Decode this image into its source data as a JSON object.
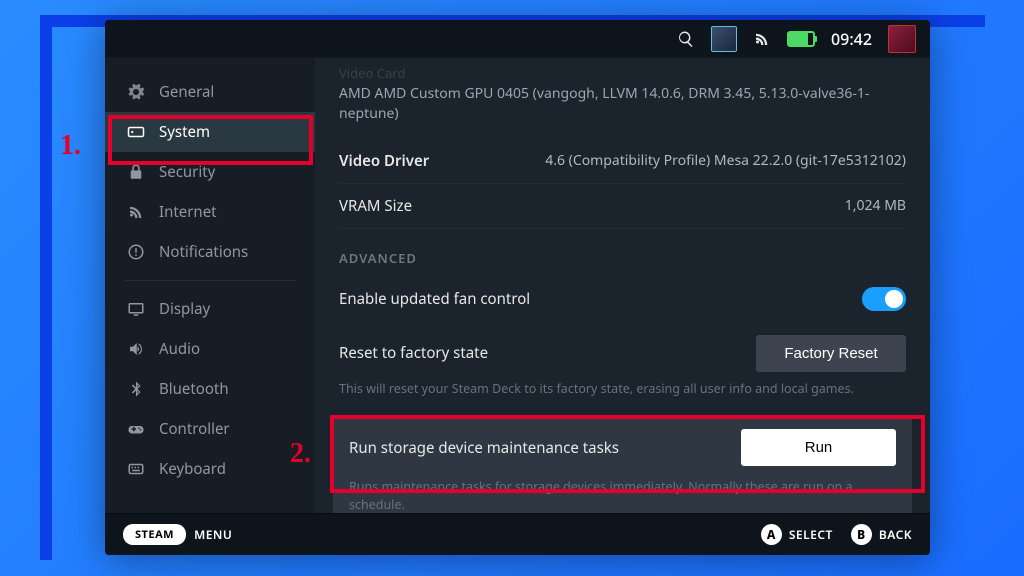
{
  "status_bar": {
    "time": "09:42"
  },
  "sidebar": {
    "items": [
      {
        "id": "general",
        "label": "General"
      },
      {
        "id": "system",
        "label": "System",
        "active": true
      },
      {
        "id": "security",
        "label": "Security"
      },
      {
        "id": "internet",
        "label": "Internet"
      },
      {
        "id": "notifications",
        "label": "Notifications"
      },
      {
        "id": "display",
        "label": "Display"
      },
      {
        "id": "audio",
        "label": "Audio"
      },
      {
        "id": "bluetooth",
        "label": "Bluetooth"
      },
      {
        "id": "controller",
        "label": "Controller"
      },
      {
        "id": "keyboard",
        "label": "Keyboard"
      }
    ]
  },
  "content": {
    "video_card_label": "Video Card",
    "video_card_value": "AMD AMD Custom GPU 0405 (vangogh, LLVM 14.0.6, DRM 3.45, 5.13.0-valve36-1-neptune)",
    "video_driver_label": "Video Driver",
    "video_driver_value": "4.6 (Compatibility Profile) Mesa 22.2.0 (git-17e5312102)",
    "vram_label": "VRAM Size",
    "vram_value": "1,024 MB",
    "advanced_title": "ADVANCED",
    "fan_label": "Enable updated fan control",
    "reset_label": "Reset to factory state",
    "reset_button": "Factory Reset",
    "reset_desc": "This will reset your Steam Deck to its factory state, erasing all user info and local games.",
    "maint_label": "Run storage device maintenance tasks",
    "maint_button": "Run",
    "maint_desc": "Runs maintenance tasks for storage devices immediately. Normally these are run on a schedule."
  },
  "bottom": {
    "steam_label": "STEAM",
    "menu_label": "MENU",
    "select_label": "SELECT",
    "select_key": "A",
    "back_label": "BACK",
    "back_key": "B"
  },
  "annotations": {
    "step1": "1.",
    "step2": "2."
  }
}
